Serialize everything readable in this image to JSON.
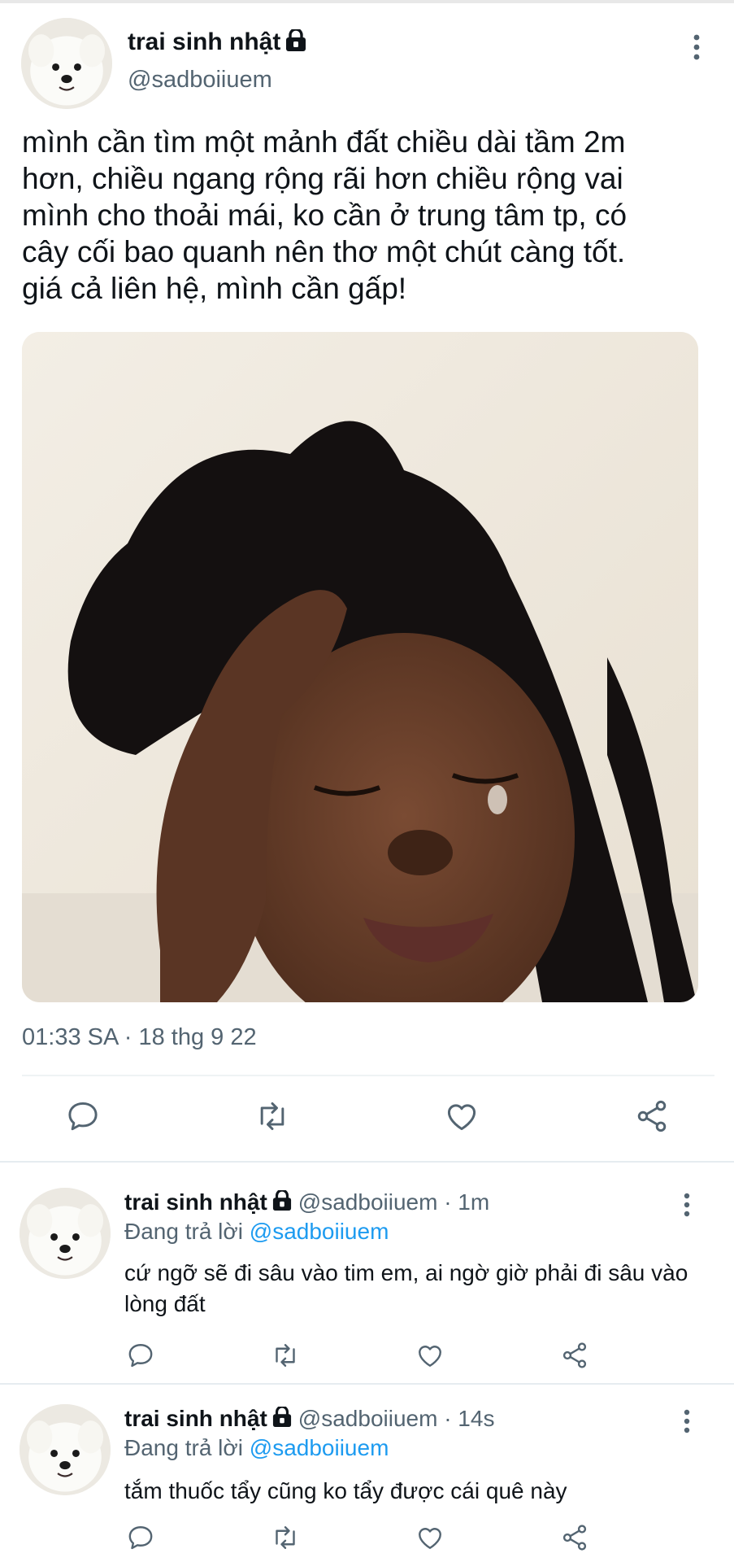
{
  "main_tweet": {
    "display_name": "trai sinh nhật",
    "handle": "@sadboiiuem",
    "text": "mình cần tìm một mảnh đất chiều dài tầm 2m\nhơn, chiều ngang rộng rãi hơn chiều rộng vai\nmình cho thoải mái, ko cần ở trung tâm tp, có\ncây cối bao quanh nên thơ một chút càng tốt.\ngiá cả liên hệ, mình cần gấp!",
    "timestamp": "01:33 SA · 18 thg 9 22"
  },
  "replies": [
    {
      "display_name": "trai sinh nhật",
      "handle": "@sadboiiuem · 1m",
      "replying_prefix": "Đang trả lời ",
      "replying_to": "@sadboiiuem",
      "text": "cứ ngỡ sẽ đi sâu vào tim em, ai ngờ giờ phải đi sâu vào lòng đất"
    },
    {
      "display_name": "trai sinh nhật",
      "handle": "@sadboiiuem · 14s",
      "replying_prefix": "Đang trả lời ",
      "replying_to": "@sadboiiuem",
      "text": "tắm thuốc tẩy cũng ko tẩy được cái quê này"
    }
  ],
  "icons": {
    "reply": "speech-bubble-icon",
    "retweet": "retweet-icon",
    "like": "heart-icon",
    "share": "share-icon",
    "more": "vertical-ellipsis-icon",
    "lock": "lock-icon"
  },
  "colors": {
    "text": "#0f1419",
    "secondary": "#536471",
    "link": "#1d9bf0",
    "divider": "#eff3f4"
  }
}
